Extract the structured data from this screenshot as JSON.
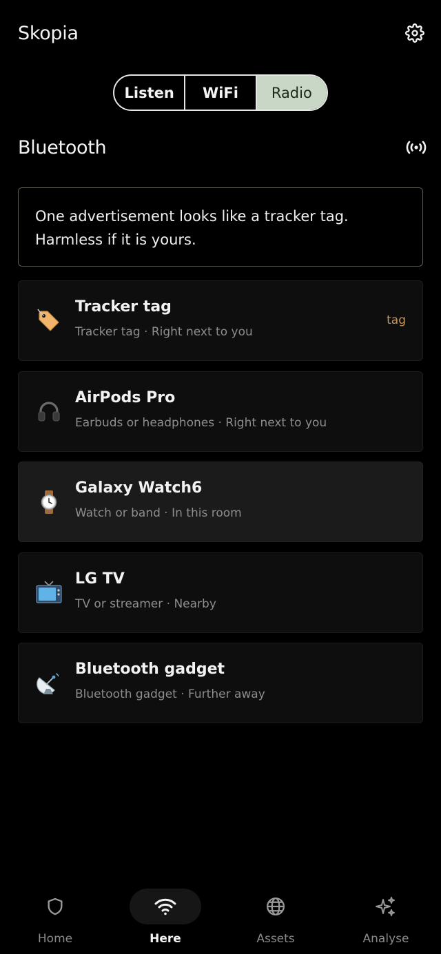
{
  "header": {
    "title": "Skopia",
    "settings_icon": "gear-icon"
  },
  "mode_tabs": [
    {
      "label": "Listen",
      "active": false
    },
    {
      "label": "WiFi",
      "active": false
    },
    {
      "label": "Radio",
      "active": true
    }
  ],
  "section": {
    "title": "Bluetooth",
    "action_icon": "broadcast-icon"
  },
  "notice": {
    "line1": "One advertisement looks like a tracker tag.",
    "line2": "Harmless if it is yours."
  },
  "devices": [
    {
      "name": "Tracker tag",
      "subtitle": "Tracker tag · Right next to you",
      "icon": "tag-icon",
      "badge": "tag"
    },
    {
      "name": "AirPods Pro",
      "subtitle": "Earbuds or headphones · Right next to you",
      "icon": "headphones-icon"
    },
    {
      "name": "Galaxy Watch6",
      "subtitle": "Watch or band · In this room",
      "icon": "watch-icon",
      "highlighted": true
    },
    {
      "name": "LG TV",
      "subtitle": "TV or streamer · Nearby",
      "icon": "tv-icon"
    },
    {
      "name": "Bluetooth gadget",
      "subtitle": "Bluetooth gadget · Further away",
      "icon": "satellite-dish-icon"
    }
  ],
  "nav": [
    {
      "label": "Home",
      "icon": "shield-icon",
      "active": false
    },
    {
      "label": "Here",
      "icon": "wifi-icon",
      "active": true
    },
    {
      "label": "Assets",
      "icon": "globe-icon",
      "active": false
    },
    {
      "label": "Analyse",
      "icon": "sparkles-icon",
      "active": false
    }
  ],
  "colors": {
    "accent_segment": "#c8d7c6",
    "badge": "#c9975b",
    "background": "#000000"
  }
}
